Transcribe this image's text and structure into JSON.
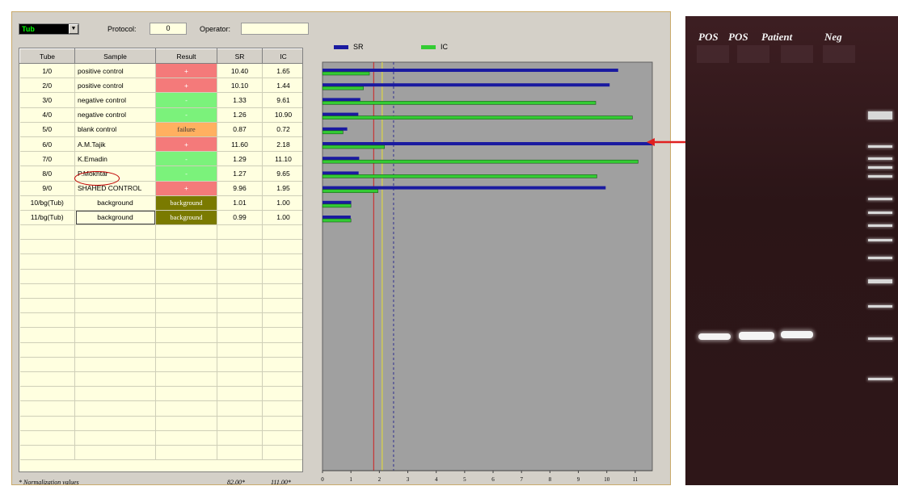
{
  "toolbar": {
    "tub_value": "Tub",
    "protocol_label": "Protocol:",
    "protocol_value": "0",
    "operator_label": "Operator:",
    "operator_value": ""
  },
  "table": {
    "headers": [
      "Tube",
      "Sample",
      "Result",
      "SR",
      "IC"
    ],
    "rows": [
      {
        "tube": "1/0",
        "sample": "positive control",
        "result": "+",
        "status": "pos",
        "sr": "10.40",
        "ic": "1.65"
      },
      {
        "tube": "2/0",
        "sample": "positive control",
        "result": "+",
        "status": "pos",
        "sr": "10.10",
        "ic": "1.44"
      },
      {
        "tube": "3/0",
        "sample": "negative control",
        "result": "-",
        "status": "neg",
        "sr": "1.33",
        "ic": "9.61"
      },
      {
        "tube": "4/0",
        "sample": "negative control",
        "result": "-",
        "status": "neg",
        "sr": "1.26",
        "ic": "10.90"
      },
      {
        "tube": "5/0",
        "sample": "blank control",
        "result": "failure",
        "status": "fail",
        "sr": "0.87",
        "ic": "0.72"
      },
      {
        "tube": "6/0",
        "sample": "A.M.Tajik",
        "result": "+",
        "status": "pos",
        "sr": "11.60",
        "ic": "2.18"
      },
      {
        "tube": "7/0",
        "sample": "K.Emadin",
        "result": "-",
        "status": "neg",
        "sr": "1.29",
        "ic": "11.10"
      },
      {
        "tube": "8/0",
        "sample": "P.Mokhtar",
        "result": "-",
        "status": "neg",
        "sr": "1.27",
        "ic": "9.65"
      },
      {
        "tube": "9/0",
        "sample": "SHAHED CONTROL",
        "result": "+",
        "status": "pos",
        "sr": "9.96",
        "ic": "1.95"
      },
      {
        "tube": "10/bg(Tub)",
        "sample": "background",
        "result": "background",
        "status": "bg",
        "sr": "1.01",
        "ic": "1.00"
      },
      {
        "tube": "11/bg(Tub)",
        "sample": "background",
        "result": "background",
        "status": "bg",
        "sr": "0.99",
        "ic": "1.00"
      }
    ],
    "empty_rows": 16
  },
  "footer": {
    "note": "* Normalization values",
    "sr_norm": "82.00*",
    "ic_norm": "111.00*"
  },
  "chart_data": {
    "type": "bar",
    "orientation": "horizontal",
    "categories": [
      "1/0",
      "2/0",
      "3/0",
      "4/0",
      "5/0",
      "6/0",
      "7/0",
      "8/0",
      "9/0",
      "10/bg(Tub)",
      "11/bg(Tub)"
    ],
    "series": [
      {
        "name": "SR",
        "color": "#1a1aa0",
        "values": [
          10.4,
          10.1,
          1.33,
          1.26,
          0.87,
          11.6,
          1.29,
          1.27,
          9.96,
          1.01,
          0.99
        ]
      },
      {
        "name": "IC",
        "color": "#33cc33",
        "values": [
          1.65,
          1.44,
          9.61,
          10.9,
          0.72,
          2.18,
          11.1,
          9.65,
          1.95,
          1.0,
          1.0
        ]
      }
    ],
    "xlim": [
      0,
      11.6
    ],
    "xticks": [
      "0",
      "1",
      "2",
      "3",
      "4",
      "5",
      "6",
      "7",
      "8",
      "9",
      "10",
      "11"
    ],
    "thresholds": [
      {
        "value": 1.8,
        "color": "#d02020",
        "style": "solid"
      },
      {
        "value": 2.1,
        "color": "#e8e030",
        "style": "solid"
      },
      {
        "value": 2.5,
        "color": "#303090",
        "style": "dashed"
      }
    ],
    "background": "#a0a0a0",
    "legend_position": "top"
  },
  "gel": {
    "labels": [
      "POS",
      "POS",
      "Patient",
      "Neg"
    ]
  },
  "annotation": {
    "highlighted_row": "6/0",
    "arrow_color": "#e02020"
  }
}
